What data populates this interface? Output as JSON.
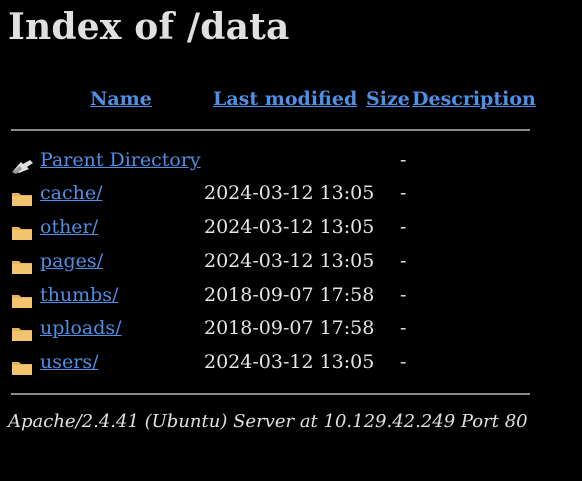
{
  "page": {
    "title": "Index of /data"
  },
  "table": {
    "headers": {
      "name": "Name",
      "last_modified": "Last modified",
      "size": "Size",
      "description": "Description"
    },
    "rows": [
      {
        "icon": "back-icon",
        "name": "Parent Directory",
        "modified": "",
        "size": "-"
      },
      {
        "icon": "folder-icon",
        "name": "cache/",
        "modified": "2024-03-12 13:05",
        "size": "-"
      },
      {
        "icon": "folder-icon",
        "name": "other/",
        "modified": "2024-03-12 13:05",
        "size": "-"
      },
      {
        "icon": "folder-icon",
        "name": "pages/",
        "modified": "2024-03-12 13:05",
        "size": "-"
      },
      {
        "icon": "folder-icon",
        "name": "thumbs/",
        "modified": "2018-09-07 17:58",
        "size": "-"
      },
      {
        "icon": "folder-icon",
        "name": "uploads/",
        "modified": "2018-09-07 17:58",
        "size": "-"
      },
      {
        "icon": "folder-icon",
        "name": "users/",
        "modified": "2024-03-12 13:05",
        "size": "-"
      }
    ]
  },
  "footer": {
    "text": "Apache/2.4.41 (Ubuntu) Server at 10.129.42.249 Port 80"
  },
  "colors": {
    "background": "#000000",
    "link": "#4f8fe6",
    "text": "#e6e6e6",
    "folder": "#e8b25a"
  }
}
